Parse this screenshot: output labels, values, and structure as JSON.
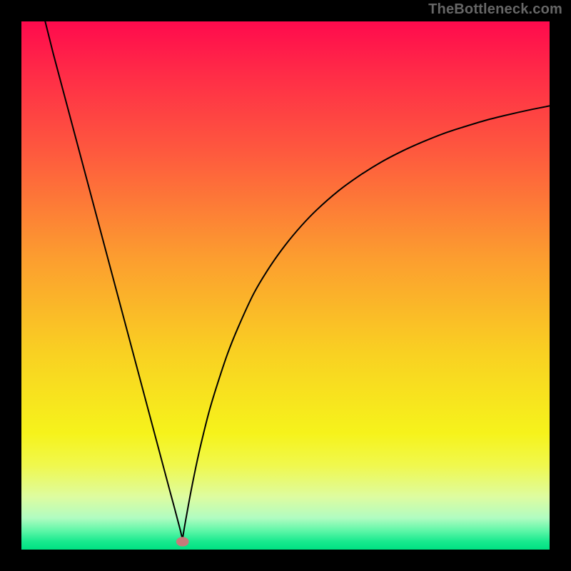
{
  "branding": "TheBottleneck.com",
  "colors": {
    "frame": "#000000",
    "curve": "#000000",
    "marker": "#C77A7A",
    "gradient_stops": [
      {
        "offset": 0.0,
        "color": "#FF0A4D"
      },
      {
        "offset": 0.1,
        "color": "#FF2C47"
      },
      {
        "offset": 0.25,
        "color": "#FE5A3E"
      },
      {
        "offset": 0.45,
        "color": "#FC9E2F"
      },
      {
        "offset": 0.63,
        "color": "#F9D122"
      },
      {
        "offset": 0.78,
        "color": "#F6F31B"
      },
      {
        "offset": 0.84,
        "color": "#F0F84D"
      },
      {
        "offset": 0.9,
        "color": "#DEFCA0"
      },
      {
        "offset": 0.94,
        "color": "#B1FCC1"
      },
      {
        "offset": 0.965,
        "color": "#5CF6A7"
      },
      {
        "offset": 0.985,
        "color": "#17E98E"
      },
      {
        "offset": 1.0,
        "color": "#00E183"
      }
    ]
  },
  "chart_data": {
    "type": "line",
    "title": "",
    "xlabel": "",
    "ylabel": "",
    "xlim": [
      0,
      100
    ],
    "ylim": [
      0,
      100
    ],
    "grid": false,
    "legend": false,
    "marker": {
      "x": 30.5,
      "y": 1.5
    },
    "series": [
      {
        "name": "left-branch",
        "x": [
          4.5,
          6,
          8,
          10,
          12,
          14,
          16,
          18,
          20,
          22,
          24,
          26,
          28,
          29,
          30,
          30.5
        ],
        "values": [
          100,
          94,
          86.5,
          79,
          71.5,
          64,
          56.5,
          49,
          41.5,
          34,
          26.5,
          19,
          11.5,
          7.8,
          4,
          2
        ]
      },
      {
        "name": "right-branch",
        "x": [
          30.5,
          31,
          32,
          33,
          34,
          35.5,
          37,
          39,
          41,
          44,
          47,
          50,
          53,
          56,
          60,
          64,
          68,
          72,
          76,
          80,
          84,
          88,
          92,
          96,
          100
        ],
        "values": [
          2,
          5,
          10.5,
          15.5,
          20,
          26,
          31,
          37,
          42,
          48.5,
          53.5,
          57.7,
          61.3,
          64.4,
          67.9,
          70.8,
          73.3,
          75.4,
          77.2,
          78.8,
          80.1,
          81.3,
          82.3,
          83.2,
          84
        ]
      }
    ]
  }
}
